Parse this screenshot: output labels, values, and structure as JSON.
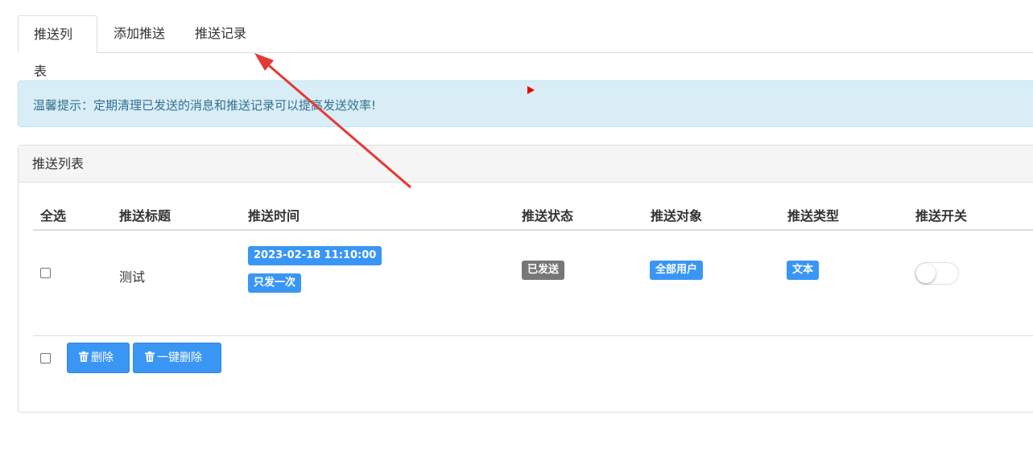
{
  "tabs": [
    {
      "label": "推送列表",
      "active": true
    },
    {
      "label": "添加推送",
      "active": false
    },
    {
      "label": "推送记录",
      "active": false
    }
  ],
  "alert": {
    "text": "温馨提示：定期清理已发送的消息和推送记录可以提高发送效率!"
  },
  "panel": {
    "title": "推送列表"
  },
  "table": {
    "headers": [
      "全选",
      "推送标题",
      "推送时间",
      "推送状态",
      "推送对象",
      "推送类型",
      "推送开关"
    ],
    "rows": [
      {
        "title": "测试",
        "time": "2023-02-18 11:10:00",
        "frequency": "只发一次",
        "status": "已发送",
        "target": "全部用户",
        "type": "文本",
        "switch_on": false,
        "checked": false
      }
    ]
  },
  "actions": {
    "delete_label": "删除",
    "delete_all_label": "一键删除"
  },
  "icons": {
    "delete": "trash-icon"
  },
  "colors": {
    "primary": "#3a96f4",
    "status_sent": "#777777",
    "alert_bg": "#d9edf7",
    "alert_text": "#31708f",
    "annotation": "#e53935"
  }
}
